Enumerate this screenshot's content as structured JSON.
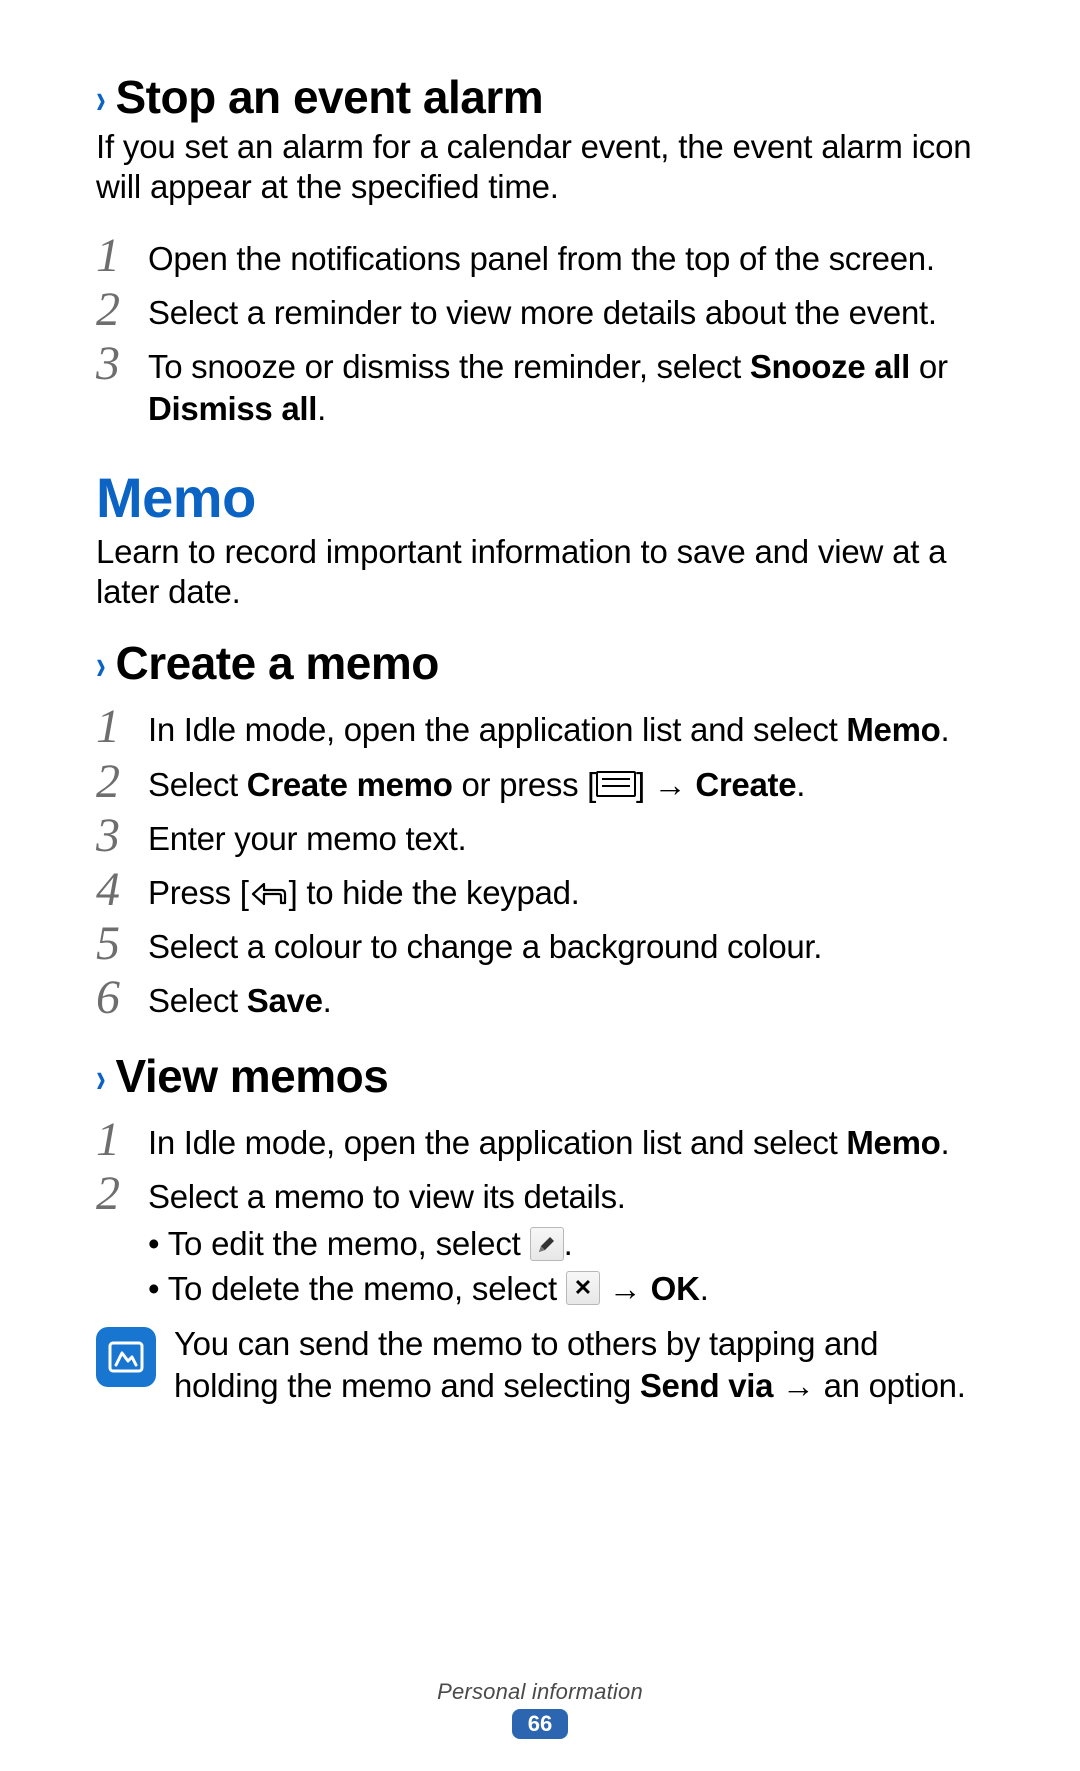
{
  "section1": {
    "heading": "Stop an event alarm",
    "intro": "If you set an alarm for a calendar event, the event alarm icon will appear at the specified time.",
    "steps": {
      "s1": "Open the notifications panel from the top of the screen.",
      "s2": "Select a reminder to view more details about the event.",
      "s3_a": "To snooze or dismiss the reminder, select ",
      "s3_b": "Snooze all",
      "s3_c": " or ",
      "s3_d": "Dismiss all",
      "s3_e": "."
    }
  },
  "memo": {
    "title": "Memo",
    "intro": "Learn to record important information to save and view at a later date."
  },
  "create": {
    "heading": "Create a memo",
    "s1_a": "In Idle mode, open the application list and select ",
    "s1_b": "Memo",
    "s1_c": ".",
    "s2_a": "Select ",
    "s2_b": "Create memo",
    "s2_c": " or press [",
    "s2_d": "] → ",
    "s2_e": "Create",
    "s2_f": ".",
    "s3": "Enter your memo text.",
    "s4_a": "Press [",
    "s4_b": "] to hide the keypad.",
    "s5": "Select a colour to change a background colour.",
    "s6_a": "Select ",
    "s6_b": "Save",
    "s6_c": "."
  },
  "view": {
    "heading": "View memos",
    "s1_a": "In Idle mode, open the application list and select ",
    "s1_b": "Memo",
    "s1_c": ".",
    "s2": "Select a memo to view its details.",
    "b1_a": "To edit the memo, select ",
    "b1_b": ".",
    "b2_a": "To delete the memo, select ",
    "b2_b": " → ",
    "b2_c": "OK",
    "b2_d": ".",
    "note_a": "You can send the memo to others by tapping and holding the memo and selecting ",
    "note_b": "Send via",
    "note_c": " → an option."
  },
  "footer": {
    "label": "Personal information",
    "page": "66"
  }
}
